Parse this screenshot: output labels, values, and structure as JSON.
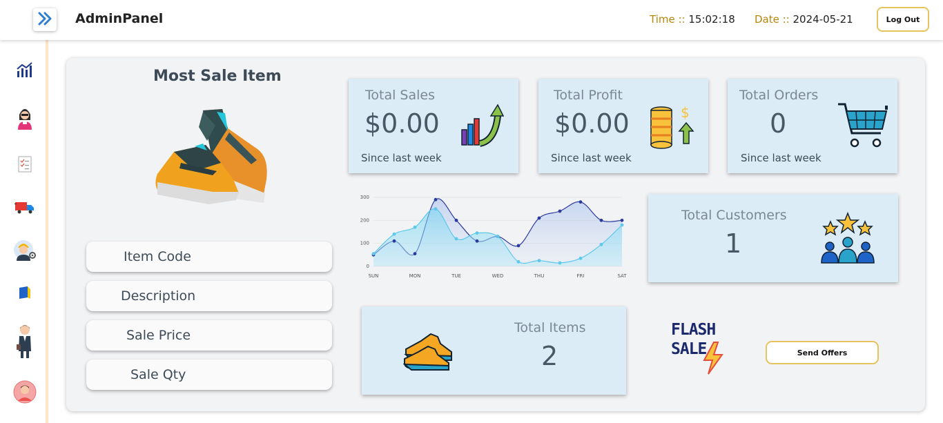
{
  "header": {
    "brand": "AdminPanel",
    "time_label": "Time ::",
    "time_value": "15:02:18",
    "date_label": "Date ::",
    "date_value": "2024-05-21",
    "logout_label": "Log Out"
  },
  "sidebar": {
    "items": [
      {
        "icon": "analytics-icon"
      },
      {
        "icon": "employee-icon"
      },
      {
        "icon": "checklist-icon"
      },
      {
        "icon": "delivery-truck-icon"
      },
      {
        "icon": "worker-settings-icon"
      },
      {
        "icon": "card-icon"
      },
      {
        "icon": "businessman-icon"
      },
      {
        "icon": "user-avatar-icon"
      }
    ]
  },
  "most_sale": {
    "title": "Most Sale Item",
    "fields": [
      "Item Code",
      "Description",
      "Sale Price",
      "Sale Qty"
    ]
  },
  "stats": {
    "total_sales": {
      "title": "Total Sales",
      "value": "$0.00",
      "sub": "Since last week"
    },
    "total_profit": {
      "title": "Total Profit",
      "value": "$0.00",
      "sub": "Since last week"
    },
    "total_orders": {
      "title": "Total Orders",
      "value": "0",
      "sub": "Since last week"
    },
    "total_customers": {
      "title": "Total Customers",
      "value": "1"
    },
    "total_items": {
      "title": "Total Items",
      "value": "2"
    }
  },
  "flash": {
    "line1": "FLASH",
    "line2": "SALE"
  },
  "send_offers_label": "Send Offers",
  "colors": {
    "accent_gold": "#e6c35c",
    "card_bg": "#dcecf6",
    "panel_bg": "#f2f3f5"
  },
  "chart_data": {
    "type": "area",
    "categories": [
      "SUN",
      "MON",
      "TUE",
      "WED",
      "THU",
      "FRI",
      "SAT"
    ],
    "x": [
      0,
      0.5,
      1,
      1.5,
      2,
      2.5,
      3,
      3.5,
      4,
      4.5,
      5,
      5.5,
      6
    ],
    "series": [
      {
        "color": "#2b3aa0",
        "values": [
          50,
          110,
          55,
          290,
          200,
          110,
          130,
          90,
          210,
          240,
          280,
          200,
          200
        ]
      },
      {
        "color": "#5bc8ec",
        "values": [
          55,
          140,
          170,
          250,
          120,
          145,
          130,
          20,
          25,
          15,
          35,
          95,
          180
        ]
      }
    ],
    "ylim": [
      0,
      300
    ],
    "yticks": [
      0,
      100,
      200,
      300
    ],
    "grid": true
  }
}
